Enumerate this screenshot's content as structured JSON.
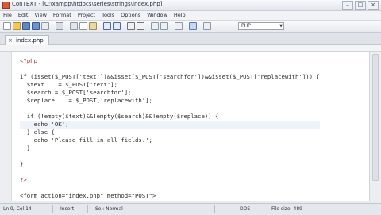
{
  "window": {
    "title": "ConTEXT - [C:\\xampp\\htdocs\\series\\strings\\index.php]",
    "controls": [
      "–",
      "□",
      "×"
    ]
  },
  "menu": [
    "File",
    "Edit",
    "View",
    "Format",
    "Project",
    "Tools",
    "Options",
    "Window",
    "Help"
  ],
  "toolbar": {
    "language": "PHP",
    "icons": [
      "new-file-icon",
      "open-icon",
      "save-icon",
      "save-all-icon",
      "close-icon",
      "print-icon",
      "cut-icon",
      "copy-icon",
      "paste-icon",
      "undo-icon",
      "redo-icon",
      "find-icon",
      "replace-icon",
      "indent-icon",
      "outdent-icon",
      "wrap-icon",
      "bookmark-icon",
      "help-icon"
    ]
  },
  "tabs": [
    {
      "label": "index.php",
      "close": "×"
    }
  ],
  "editor": {
    "current_line_index": 8,
    "lines": [
      "<?php",
      "",
      "if (isset($_POST['text'])&&isset($_POST['searchfor'])&&isset($_POST['replacewith'])) {",
      "  $text    = $_POST['text'];",
      "  $search = $_POST['searchfor'];",
      "  $replace    = $_POST['replacewith'];",
      "",
      "  if (!empty($text)&&!empty($search)&&!empty($replace)) {",
      "    echo 'OK';",
      "  } else {",
      "    echo 'Please fill in all fields.';",
      "  }",
      "",
      "}",
      "",
      "?>",
      "",
      "<form action=\"index.php\" method=\"POST\">"
    ]
  },
  "status": {
    "position": "Ln 9, Col 14",
    "mode": "Insert",
    "selection": "Sel: Normal",
    "format": "DOS",
    "file_size": "File size: 489"
  }
}
